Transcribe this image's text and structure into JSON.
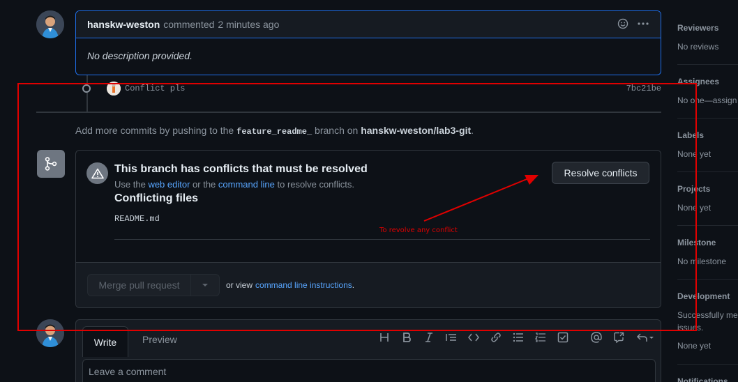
{
  "comment": {
    "author": "hanskw-weston",
    "action": "commented",
    "time": "2 minutes ago",
    "body": "No description provided.",
    "icons": [
      "smiley-icon",
      "kebab-horizontal-icon"
    ]
  },
  "commit": {
    "message": "Conflict pls",
    "sha": "7bc21be"
  },
  "push_note": {
    "prefix": "Add more commits by pushing to the",
    "branch": "feature_readme_",
    "middle": "branch on",
    "repo": "hanskw-weston/lab3-git",
    "suffix": "."
  },
  "merge": {
    "title": "This branch has conflicts that must be resolved",
    "sub_prefix": "Use the",
    "web_editor": "web editor",
    "sub_middle": "or the",
    "command_line": "command line",
    "sub_suffix": "to resolve conflicts.",
    "conflicting_title": "Conflicting files",
    "files": [
      "README.md"
    ],
    "resolve_label": "Resolve conflicts",
    "merge_label": "Merge pull request",
    "or_view": "or view",
    "cli_link": "command line instructions",
    "cli_suffix": "."
  },
  "editor": {
    "tab_write": "Write",
    "tab_preview": "Preview",
    "placeholder": "Leave a comment",
    "toolbar": [
      "heading-icon",
      "bold-icon",
      "italic-icon",
      "quote-icon",
      "code-icon",
      "link-icon",
      "unordered-list-icon",
      "ordered-list-icon",
      "tasklist-icon",
      "mention-icon",
      "cross-reference-icon",
      "reply-icon"
    ]
  },
  "sidebar": {
    "sections": [
      {
        "title": "Reviewers",
        "value": "No reviews"
      },
      {
        "title": "Assignees",
        "value": "No one—assign"
      },
      {
        "title": "Labels",
        "value": "None yet"
      },
      {
        "title": "Projects",
        "value": "None yet"
      },
      {
        "title": "Milestone",
        "value": "No milestone"
      },
      {
        "title": "Development",
        "value": "Successfully me issues.",
        "value2": "None yet"
      },
      {
        "title": "Notifications"
      }
    ]
  },
  "annotation": {
    "text": "To revolve any conflict",
    "color": "#e00000"
  },
  "colors": {
    "background": "#0d1117",
    "panel": "#161b22",
    "link": "#58a6ff",
    "focus_border": "#1f6feb"
  }
}
